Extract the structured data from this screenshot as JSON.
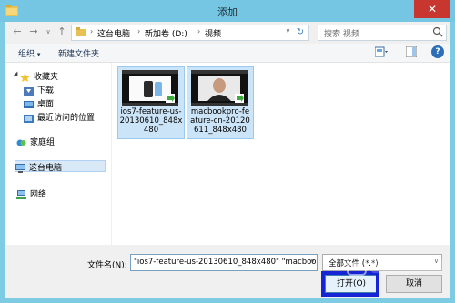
{
  "window": {
    "title": "添加",
    "close": "✕"
  },
  "address": {
    "crumbs": [
      "这台电脑",
      "新加卷 (D:)",
      "视频"
    ],
    "search_placeholder": "搜索 视频"
  },
  "commands": {
    "organize": "组织",
    "new_folder": "新建文件夹",
    "help": "?"
  },
  "nav": {
    "favorites": "收藏夹",
    "downloads": "下载",
    "desktop": "桌面",
    "recent": "最近访问的位置",
    "homegroup": "家庭组",
    "this_pc": "这台电脑",
    "network": "网络"
  },
  "files": [
    {
      "label": "ios7-feature-us-\n20130610_848x\n480"
    },
    {
      "label": "macbookpro-fe\nature-cn-20120\n611_848x480"
    }
  ],
  "bottom": {
    "filename_label": "文件名(N):",
    "filename_value": "\"ios7-feature-us-20130610_848x480\" \"macbool",
    "filetype_value": "全部文件 (*.*)",
    "open_label": "打开(O)",
    "cancel_label": "取消"
  },
  "colors": {
    "title_bar": "#75c6e2",
    "selection": "#cce4f7",
    "highlight_box": "#1525d6",
    "close": "#c7372f"
  }
}
